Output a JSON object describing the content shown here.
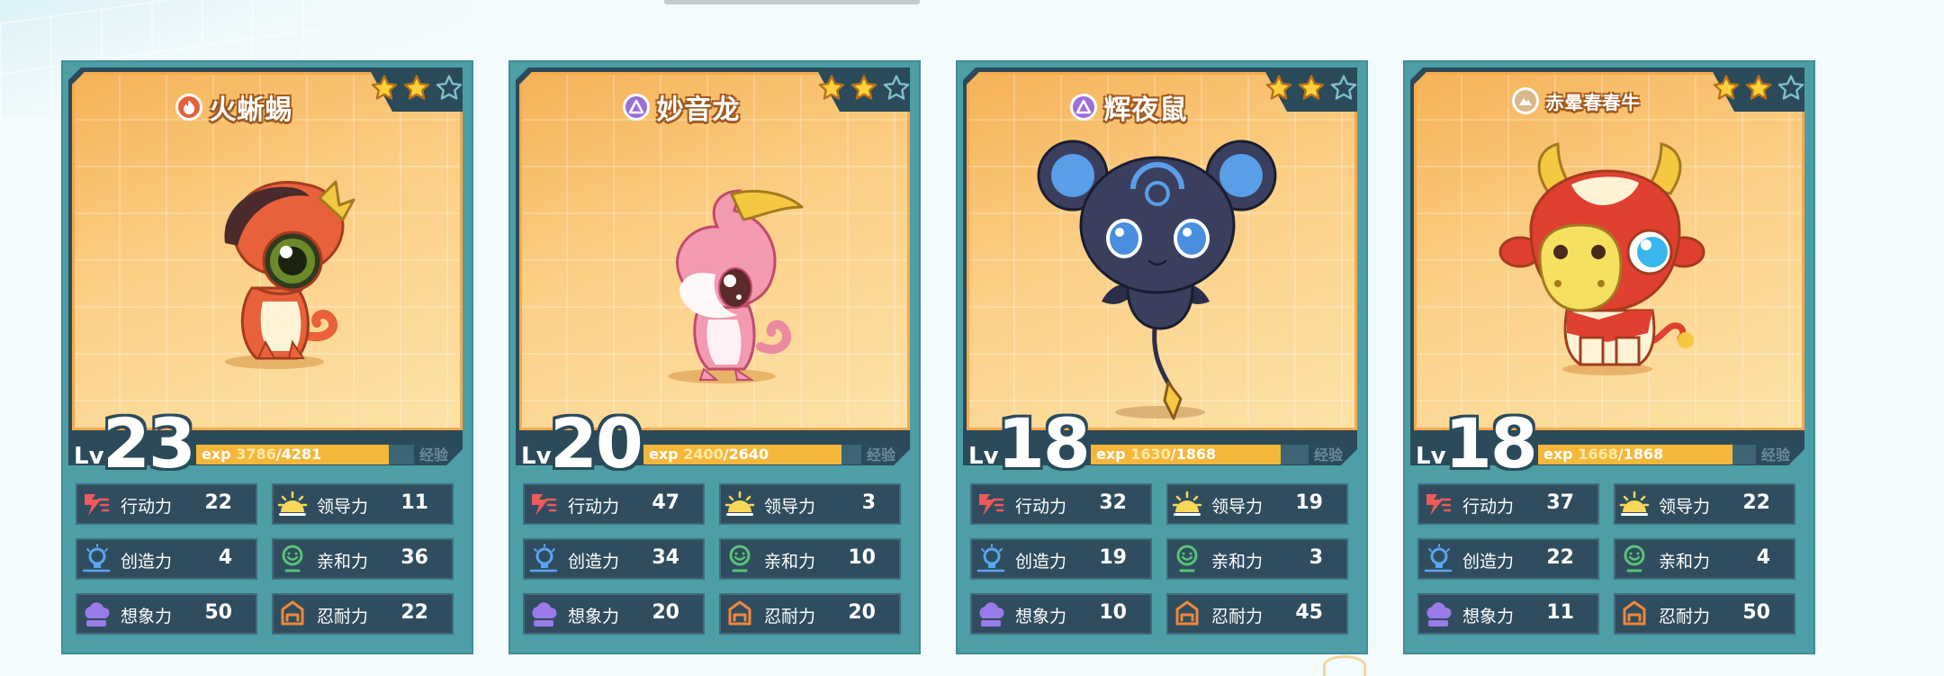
{
  "cards": [
    {
      "name": "火蜥蜴",
      "element": "fire-icon",
      "element_color": "#e8613a",
      "stars_filled": 2,
      "stars_total": 3,
      "level": "23",
      "level_prefix": "Lv",
      "exp_label": "exp",
      "exp_current": "3786",
      "exp_total": "/4281",
      "exp_fraction": 0.884,
      "exp_button": "经验",
      "stats": [
        {
          "label": "行动力",
          "value": "22",
          "icon": "action-icon"
        },
        {
          "label": "领导力",
          "value": "11",
          "icon": "leadership-icon"
        },
        {
          "label": "创造力",
          "value": "4",
          "icon": "creativity-icon"
        },
        {
          "label": "亲和力",
          "value": "36",
          "icon": "affinity-icon"
        },
        {
          "label": "想象力",
          "value": "50",
          "icon": "imagination-icon"
        },
        {
          "label": "忍耐力",
          "value": "22",
          "icon": "endurance-icon"
        }
      ]
    },
    {
      "name": "妙音龙",
      "element": "sound-icon",
      "element_color": "#9b6fd6",
      "stars_filled": 2,
      "stars_total": 3,
      "level": "20",
      "level_prefix": "Lv",
      "exp_label": "exp",
      "exp_current": "2400",
      "exp_total": "/2640",
      "exp_fraction": 0.909,
      "exp_button": "经验",
      "stats": [
        {
          "label": "行动力",
          "value": "47",
          "icon": "action-icon"
        },
        {
          "label": "领导力",
          "value": "3",
          "icon": "leadership-icon"
        },
        {
          "label": "创造力",
          "value": "34",
          "icon": "creativity-icon"
        },
        {
          "label": "亲和力",
          "value": "10",
          "icon": "affinity-icon"
        },
        {
          "label": "想象力",
          "value": "20",
          "icon": "imagination-icon"
        },
        {
          "label": "忍耐力",
          "value": "20",
          "icon": "endurance-icon"
        }
      ]
    },
    {
      "name": "辉夜鼠",
      "element": "dark-icon",
      "element_color": "#9b6fd6",
      "stars_filled": 2,
      "stars_total": 3,
      "level": "18",
      "level_prefix": "Lv",
      "exp_label": "exp",
      "exp_current": "1630",
      "exp_total": "/1868",
      "exp_fraction": 0.873,
      "exp_button": "经验",
      "stats": [
        {
          "label": "行动力",
          "value": "32",
          "icon": "action-icon"
        },
        {
          "label": "领导力",
          "value": "19",
          "icon": "leadership-icon"
        },
        {
          "label": "创造力",
          "value": "19",
          "icon": "creativity-icon"
        },
        {
          "label": "亲和力",
          "value": "3",
          "icon": "affinity-icon"
        },
        {
          "label": "想象力",
          "value": "10",
          "icon": "imagination-icon"
        },
        {
          "label": "忍耐力",
          "value": "45",
          "icon": "endurance-icon"
        }
      ]
    },
    {
      "name": "赤晕春春牛",
      "element": "earth-icon",
      "element_color": "#d9b98a",
      "stars_filled": 2,
      "stars_total": 3,
      "level": "18",
      "level_prefix": "Lv",
      "exp_label": "exp",
      "exp_current": "1668",
      "exp_total": "/1868",
      "exp_fraction": 0.893,
      "exp_button": "经验",
      "stats": [
        {
          "label": "行动力",
          "value": "37",
          "icon": "action-icon"
        },
        {
          "label": "领导力",
          "value": "22",
          "icon": "leadership-icon"
        },
        {
          "label": "创造力",
          "value": "22",
          "icon": "creativity-icon"
        },
        {
          "label": "亲和力",
          "value": "4",
          "icon": "affinity-icon"
        },
        {
          "label": "想象力",
          "value": "11",
          "icon": "imagination-icon"
        },
        {
          "label": "忍耐力",
          "value": "50",
          "icon": "endurance-icon"
        }
      ]
    }
  ]
}
